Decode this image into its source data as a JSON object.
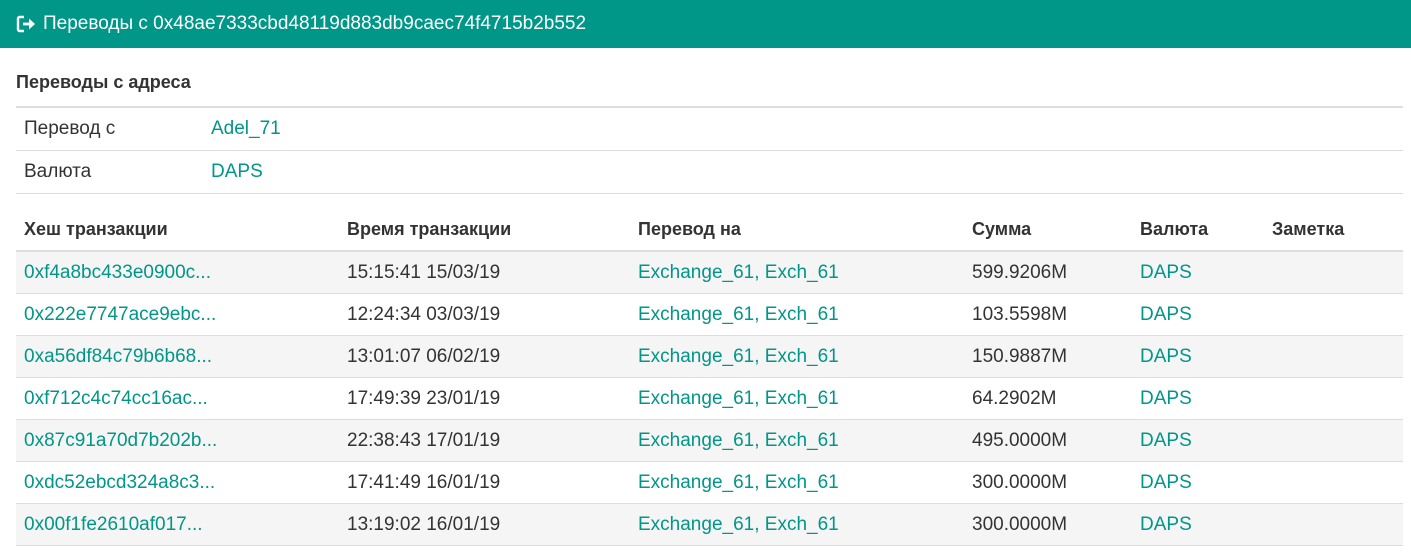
{
  "header": {
    "title": "Переводы с 0x48ae7333cbd48119d883db9caec74f4715b2b552",
    "icon": "sign-out-icon"
  },
  "section": {
    "title": "Переводы с адреса"
  },
  "info": {
    "from_label": "Перевод с",
    "from_value": "Adel_71",
    "currency_label": "Валюта",
    "currency_value": "DAPS"
  },
  "table": {
    "columns": [
      "Хеш транзакции",
      "Время транзакции",
      "Перевод на",
      "Сумма",
      "Валюта",
      "Заметка"
    ],
    "rows": [
      {
        "hash": "0xf4a8bc433e0900c...",
        "time": "15:15:41 15/03/19",
        "to": "Exchange_61, Exch_61",
        "amount": "599.9206M",
        "currency": "DAPS",
        "note": ""
      },
      {
        "hash": "0x222e7747ace9ebc...",
        "time": "12:24:34 03/03/19",
        "to": "Exchange_61, Exch_61",
        "amount": "103.5598M",
        "currency": "DAPS",
        "note": ""
      },
      {
        "hash": "0xa56df84c79b6b68...",
        "time": "13:01:07 06/02/19",
        "to": "Exchange_61, Exch_61",
        "amount": "150.9887M",
        "currency": "DAPS",
        "note": ""
      },
      {
        "hash": "0xf712c4c74cc16ac...",
        "time": "17:49:39 23/01/19",
        "to": "Exchange_61, Exch_61",
        "amount": "64.2902M",
        "currency": "DAPS",
        "note": ""
      },
      {
        "hash": "0x87c91a70d7b202b...",
        "time": "22:38:43 17/01/19",
        "to": "Exchange_61, Exch_61",
        "amount": "495.0000M",
        "currency": "DAPS",
        "note": ""
      },
      {
        "hash": "0xdc52ebcd324a8c3...",
        "time": "17:41:49 16/01/19",
        "to": "Exchange_61, Exch_61",
        "amount": "300.0000M",
        "currency": "DAPS",
        "note": ""
      },
      {
        "hash": "0x00f1fe2610af017...",
        "time": "13:19:02 16/01/19",
        "to": "Exchange_61, Exch_61",
        "amount": "300.0000M",
        "currency": "DAPS",
        "note": ""
      }
    ]
  },
  "colors": {
    "accent": "#009688",
    "header_text": "#ffffff",
    "stripe": "#f5f5f5"
  }
}
